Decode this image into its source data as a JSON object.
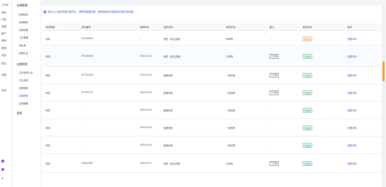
{
  "rail": {
    "items": [
      "工作台",
      "商品",
      "订单",
      "店铺",
      "客户",
      "营销",
      "数据",
      "内容",
      "财务",
      "设置",
      "应用"
    ]
  },
  "sidebar": {
    "groups": [
      {
        "label": "店铺管理",
        "items": [
          {
            "label": "店铺信息",
            "active": false
          },
          {
            "label": "店铺装修",
            "active": false
          },
          {
            "label": "店铺设置",
            "active": false
          },
          {
            "label": "门店管理",
            "active": false
          },
          {
            "label": "地址库",
            "active": false
          },
          {
            "label": "店铺认证",
            "active": false
          }
        ]
      },
      {
        "label": "店铺资质",
        "items": [
          {
            "label": "主体资质认证",
            "active": false
          },
          {
            "label": "行业资质",
            "active": false
          },
          {
            "label": "品牌授权",
            "active": false
          },
          {
            "label": "店铺资质",
            "active": true
          },
          {
            "label": "店铺报备",
            "active": false
          }
        ]
      },
      {
        "label": "更多",
        "items": []
      }
    ]
  },
  "notice": "如对以上信息有疑问或异议，请联系客服处理，资质到期后可能影响店铺正常经营。",
  "table": {
    "headers": [
      "资质类型",
      "资质编号",
      "到期时间",
      "资质名称",
      "审核状态",
      "备注",
      "资质状态",
      "操作"
    ],
    "rows": [
      {
        "type": "有效",
        "code": "579140505",
        "date": "--",
        "name": "资质（营业执照）",
        "status": "待审核",
        "note": "--",
        "tag": "",
        "state": "待生效",
        "state_kind": "warn",
        "action": "查看详情"
      },
      {
        "type": "有效",
        "code": "570130562",
        "date": "2024-04-10",
        "name": "资质（营业执照）",
        "status": "已审核",
        "note": "",
        "tag": "已过期",
        "state": "已生效",
        "state_kind": "ok",
        "action": "查看详情"
      },
      {
        "type": "有效",
        "code": "577314263",
        "date": "2024-04-19",
        "name": "普通资质",
        "status": "一般资质",
        "note": "",
        "tag": "已过期",
        "state": "已生效",
        "state_kind": "ok",
        "action": "查看详情"
      },
      {
        "type": "有效",
        "code": "577301791",
        "date": "2024-04-08",
        "name": "普通资质",
        "status": "一般资质",
        "note": "",
        "tag": "已过期",
        "state": "已生效",
        "state_kind": "ok",
        "action": "查看详情"
      },
      {
        "type": "有效",
        "code": "--",
        "date": "2024-04-08",
        "name": "普通资质",
        "status": "一般资质",
        "note": "--",
        "tag": "",
        "state": "已生效",
        "state_kind": "ok",
        "action": "查看详情"
      },
      {
        "type": "有效",
        "code": "--",
        "date": "2024-04-08",
        "name": "普通资质",
        "status": "一般资质",
        "note": "--",
        "tag": "",
        "state": "已生效",
        "state_kind": "ok",
        "action": "查看详情"
      },
      {
        "type": "有效",
        "code": "--",
        "date": "2024-04-08",
        "name": "普通资质",
        "status": "一般资质",
        "note": "--",
        "tag": "",
        "state": "已生效",
        "state_kind": "ok",
        "action": "查看详情"
      },
      {
        "type": "有效",
        "code": "578340657",
        "date": "2024-03-21",
        "name": "资质（营业执照）",
        "status": "已审核",
        "note": "",
        "tag": "已过期",
        "state": "已生效",
        "state_kind": "ok",
        "action": "查看详情"
      }
    ]
  },
  "colors": {
    "accent": "#3a5bd9",
    "warn": "#e6883a",
    "ok": "#2d9b4f",
    "scroll": "#f5a623"
  }
}
